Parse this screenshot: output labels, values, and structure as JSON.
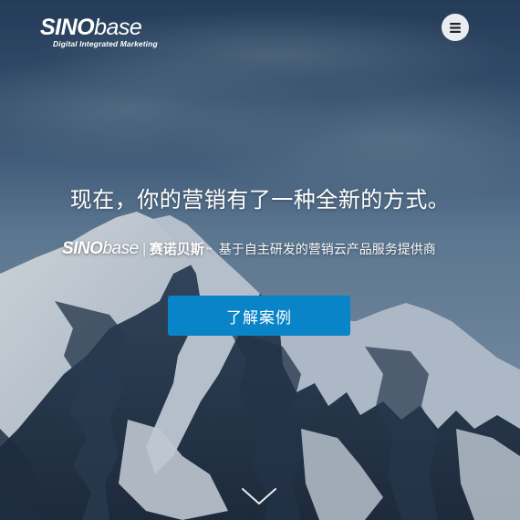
{
  "brand": {
    "name_bold": "SINO",
    "name_light": "base",
    "tagline": "Digital Integrated Marketing"
  },
  "menu": {
    "icon": "hamburger-menu-icon"
  },
  "hero": {
    "headline": "现在，你的营销有了一种全新的方式。",
    "sub_brand_bold": "SINO",
    "sub_brand_light": "base",
    "separator": "|",
    "sub_brand_cn": "赛诺贝斯",
    "trademark": "™",
    "description": "基于自主研发的营销云产品服务提供商",
    "cta_label": "了解案例"
  },
  "scroll": {
    "icon": "chevron-down-icon"
  },
  "colors": {
    "sky_top": "#2a4260",
    "sky_mid": "#5f7b96",
    "mountain_shadow": "#2b3f56",
    "snow": "#dfe6ee",
    "cta": "#0a84c9",
    "menu_button": "#e9edf2"
  }
}
